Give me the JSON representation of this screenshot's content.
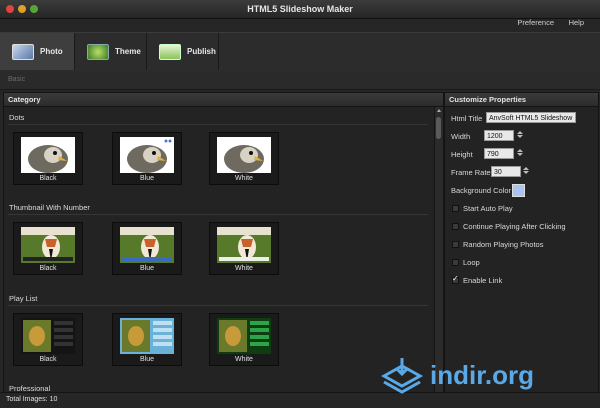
{
  "window": {
    "title": "HTML5 Slideshow Maker"
  },
  "menu": {
    "preference": "Preference",
    "help": "Help"
  },
  "tabs": [
    {
      "label": "Photo",
      "icon": "photo-icon"
    },
    {
      "label": "Theme",
      "icon": "theme-icon"
    },
    {
      "label": "Publish",
      "icon": "publish-icon"
    }
  ],
  "breadcrumb": "Basic",
  "category": {
    "header": "Category",
    "groups": [
      {
        "title": "Dots",
        "items": [
          "Black",
          "Blue",
          "White"
        ]
      },
      {
        "title": "Thumbnail With Number",
        "items": [
          "Black",
          "Blue",
          "White"
        ]
      },
      {
        "title": "Play List",
        "items": [
          "Black",
          "Blue",
          "White"
        ]
      },
      {
        "title": "Professional"
      }
    ]
  },
  "properties": {
    "header": "Customize Properties",
    "html_title_label": "Html Title",
    "html_title_value": "AnvSoft HTML5 Slideshow",
    "width_label": "Width",
    "width_value": "1200",
    "height_label": "Height",
    "height_value": "790",
    "frame_rate_label": "Frame Rate",
    "frame_rate_value": "30",
    "bg_color_label": "Background Color",
    "bg_color_value": "#a9c4ee",
    "options": [
      {
        "label": "Start Auto Play",
        "checked": false
      },
      {
        "label": "Continue Playing After Clicking",
        "checked": false
      },
      {
        "label": "Random Playing Photos",
        "checked": false
      },
      {
        "label": "Loop",
        "checked": false
      },
      {
        "label": "Enable Link",
        "checked": true
      }
    ]
  },
  "status": {
    "total_images": "Total Images: 10"
  },
  "watermark": {
    "text": "indir.org"
  },
  "colors": {
    "accent": "#4a9fd8",
    "watermark": "#5aa9e6"
  }
}
